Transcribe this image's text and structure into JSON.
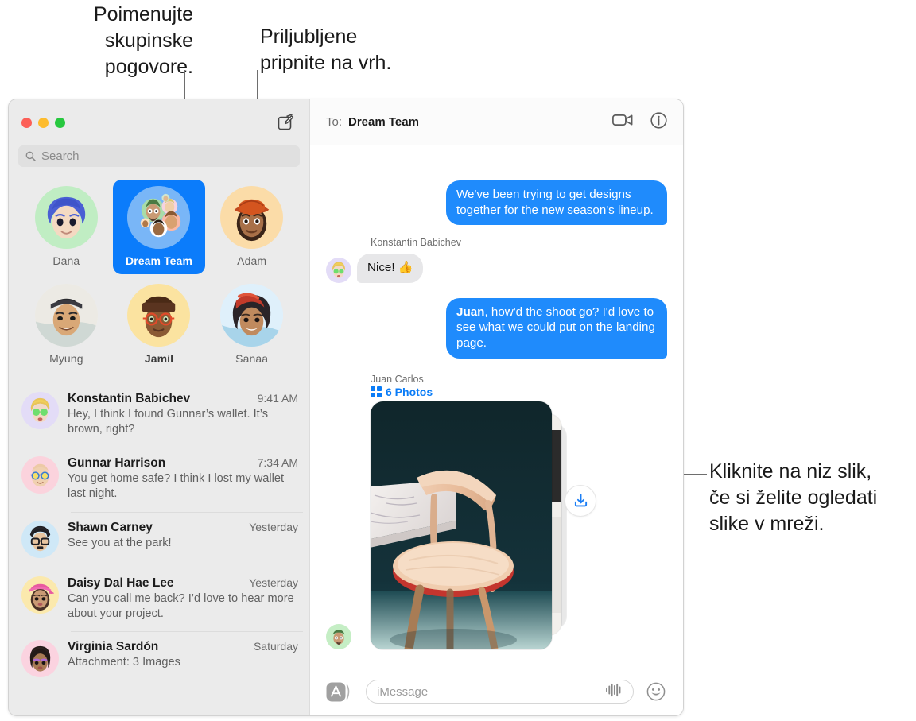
{
  "callouts": {
    "name_groups": "Poimenujte\nskupinske\npogovore.",
    "pin_favorites": "Priljubljene\npripnite na vrh.",
    "click_photos": "Kliknite na niz slik,\nče si želite ogledati\nslike v mreži."
  },
  "sidebar": {
    "compose_icon": "compose-icon",
    "search": {
      "placeholder": "Search",
      "icon": "search-icon"
    },
    "pinned": [
      {
        "label": "Dana",
        "selected": false,
        "bold": false,
        "avatar_bg": "#c0edc3"
      },
      {
        "label": "Dream Team",
        "selected": true,
        "bold": false,
        "avatar_bg": "#79b6f7"
      },
      {
        "label": "Adam",
        "selected": false,
        "bold": false,
        "avatar_bg": "#fbdca8"
      },
      {
        "label": "Myung",
        "selected": false,
        "bold": false,
        "avatar_bg": "#f2f2ee"
      },
      {
        "label": "Jamil",
        "selected": false,
        "bold": true,
        "avatar_bg": "#fbe3a0"
      },
      {
        "label": "Sanaa",
        "selected": false,
        "bold": false,
        "avatar_bg": "#dff0fb"
      }
    ],
    "conversations": [
      {
        "name": "Konstantin Babichev",
        "time": "9:41 AM",
        "snippet": "Hey, I think I found Gunnar’s wallet. It’s brown, right?",
        "avatar_bg": "#e3dcf7"
      },
      {
        "name": "Gunnar Harrison",
        "time": "7:34 AM",
        "snippet": "You get home safe? I think I lost my wallet last night.",
        "avatar_bg": "#fbd3dd"
      },
      {
        "name": "Shawn Carney",
        "time": "Yesterday",
        "snippet": "See you at the park!",
        "avatar_bg": "#cfe8f7"
      },
      {
        "name": "Daisy Dal Hae Lee",
        "time": "Yesterday",
        "snippet": "Can you call me back? I’d love to hear more about your project.",
        "avatar_bg": "#fbe9ad"
      },
      {
        "name": "Virginia Sardón",
        "time": "Saturday",
        "snippet": "Attachment: 3 Images",
        "avatar_bg": "#fbd3e0"
      }
    ]
  },
  "thread": {
    "to_label": "To:",
    "to_value": "Dream Team",
    "facetime_icon": "video-camera-icon",
    "info_icon": "info-circle-icon",
    "messages": [
      {
        "direction": "out",
        "text": "We've been trying to get designs together for the new season's lineup."
      },
      {
        "direction": "in",
        "sender": "Konstantin Babichev",
        "text": "Nice!  👍",
        "avatar_bg": "#e3dcf7"
      },
      {
        "direction": "out",
        "bold_prefix": "Juan",
        "text": ", how'd the shoot go? I'd love to see what we could put on the landing page."
      }
    ],
    "attachment": {
      "sender": "Juan Carlos",
      "count_label": "6 Photos",
      "grid_icon": "grid-icon",
      "download_icon": "download-icon",
      "avatar_bg": "#c5eec5"
    },
    "composer": {
      "apps_icon": "app-store-icon",
      "placeholder": "iMessage",
      "audio_icon": "audio-waveform-icon",
      "emoji_icon": "smiley-face-icon"
    }
  },
  "colors": {
    "accent_blue": "#1f8bfc",
    "selected_pin": "#0b7cfb",
    "link_blue": "#0a7cf7",
    "incoming_bubble": "#e7e7e9",
    "sidebar_bg": "#ebebeb"
  }
}
